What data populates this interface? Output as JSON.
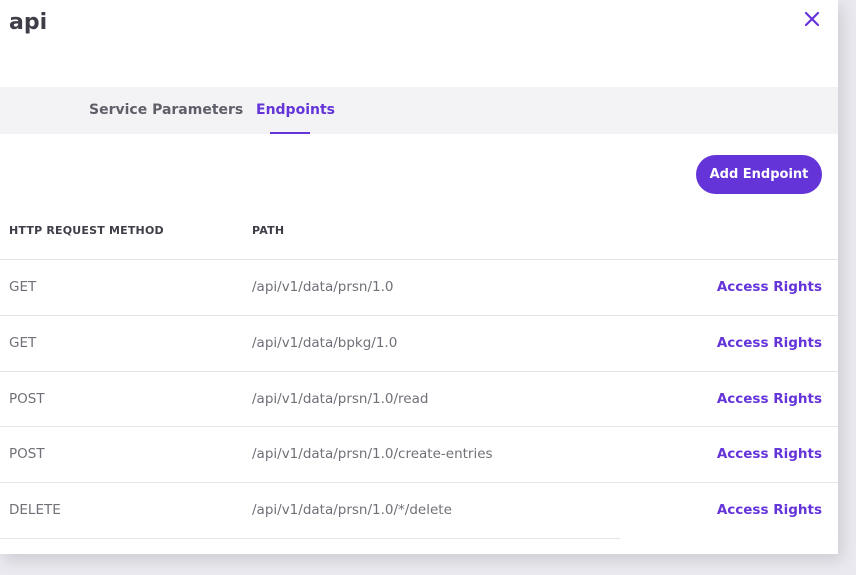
{
  "panel": {
    "title": "api"
  },
  "tabs": [
    {
      "label": "Service Parameters",
      "active": false
    },
    {
      "label": "Endpoints",
      "active": true
    }
  ],
  "toolbar": {
    "add_label": "Add Endpoint"
  },
  "table": {
    "columns": [
      "HTTP REQUEST METHOD",
      "PATH"
    ],
    "rows": [
      {
        "method": "GET",
        "path": "/api/v1/data/prsn/1.0",
        "action": "Access Rights"
      },
      {
        "method": "GET",
        "path": "/api/v1/data/bpkg/1.0",
        "action": "Access Rights"
      },
      {
        "method": "POST",
        "path": "/api/v1/data/prsn/1.0/read",
        "action": "Access Rights"
      },
      {
        "method": "POST",
        "path": "/api/v1/data/prsn/1.0/create-entries",
        "action": "Access Rights"
      },
      {
        "method": "DELETE",
        "path": "/api/v1/data/prsn/1.0/*/delete",
        "action": "Access Rights"
      }
    ]
  },
  "icons": {
    "close": "close-icon"
  },
  "colors": {
    "accent": "#6434d9",
    "title": "#3e3e48",
    "muted_text": "#707078",
    "tabbar_bg": "#f3f3f5"
  }
}
